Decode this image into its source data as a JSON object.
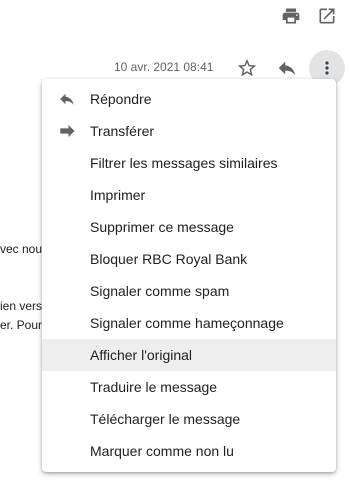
{
  "header": {
    "date": "10 avr. 2021 08:41"
  },
  "background_snippets": {
    "line1": "vec nou",
    "line2": "ien vers",
    "line3": "er. Pour"
  },
  "menu": {
    "items": [
      {
        "label": "Répondre",
        "icon": "reply-icon"
      },
      {
        "label": "Transférer",
        "icon": "forward-icon"
      },
      {
        "label": "Filtrer les messages similaires"
      },
      {
        "label": "Imprimer"
      },
      {
        "label": "Supprimer ce message"
      },
      {
        "label": "Bloquer RBC Royal Bank"
      },
      {
        "label": "Signaler comme spam"
      },
      {
        "label": "Signaler comme hameçonnage"
      },
      {
        "label": "Afficher l'original",
        "highlighted": true
      },
      {
        "label": "Traduire le message"
      },
      {
        "label": "Télécharger le message"
      },
      {
        "label": "Marquer comme non lu"
      }
    ]
  },
  "colors": {
    "icon": "#5f6368",
    "highlight": "#eeeeee"
  }
}
